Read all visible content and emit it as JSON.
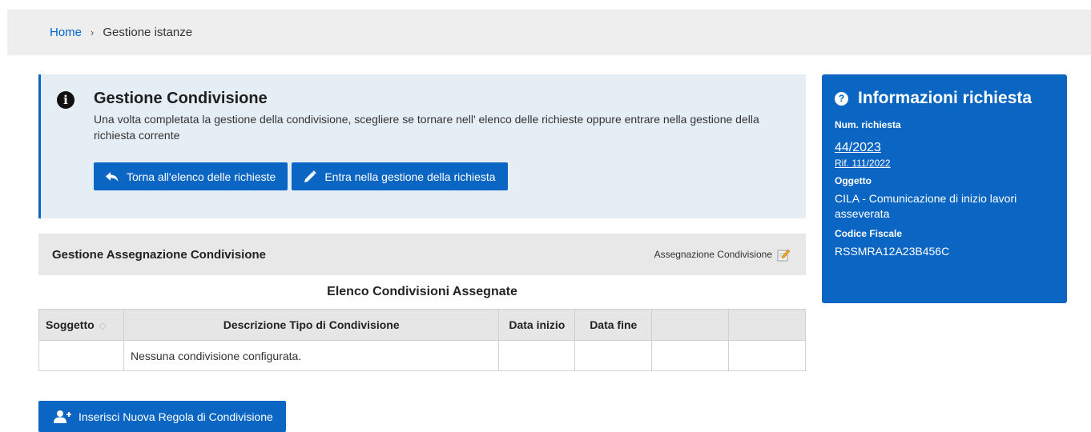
{
  "breadcrumb": {
    "home": "Home",
    "separator": "›",
    "current": "Gestione istanze"
  },
  "info": {
    "icon": "info-icon",
    "title": "Gestione Condivisione",
    "text": "Una volta completata la gestione della condivisione, scegliere se tornare nell' elenco delle richieste oppure entrare nella gestione della richiesta corrente",
    "buttons": [
      {
        "label": "Torna all'elenco delle richieste",
        "icon": "reply-arrow-icon"
      },
      {
        "label": "Entra nella gestione della richiesta",
        "icon": "pencil-icon"
      }
    ]
  },
  "section": {
    "title": "Gestione Assegnazione Condivisione",
    "action_label": "Assegnazione Condivisione",
    "action_icon": "edit-note-icon"
  },
  "table": {
    "caption": "Elenco Condivisioni Assegnate",
    "headers": [
      "Soggetto",
      "Descrizione Tipo di Condivisione",
      "Data inizio",
      "Data fine",
      "",
      ""
    ],
    "empty_message": "Nessuna condivisione configurata."
  },
  "side": {
    "title": "Informazioni richiesta",
    "num_label": "Num. richiesta",
    "num_value": "44/2023",
    "rif": "Rif. 111/2022",
    "oggetto_label": "Oggetto",
    "oggetto_value": "CILA - Comunicazione di inizio lavori asseverata",
    "cf_label": "Codice Fiscale",
    "cf_value": "RSSMRA12A23B456C"
  },
  "bottom_button": {
    "label": "Inserisci Nuova Regola di Condivisione",
    "icon": "add-user-icon"
  },
  "colors": {
    "primary": "#0a66c2",
    "info_bg": "#e6eef5",
    "header_bg": "#eeeeee"
  }
}
